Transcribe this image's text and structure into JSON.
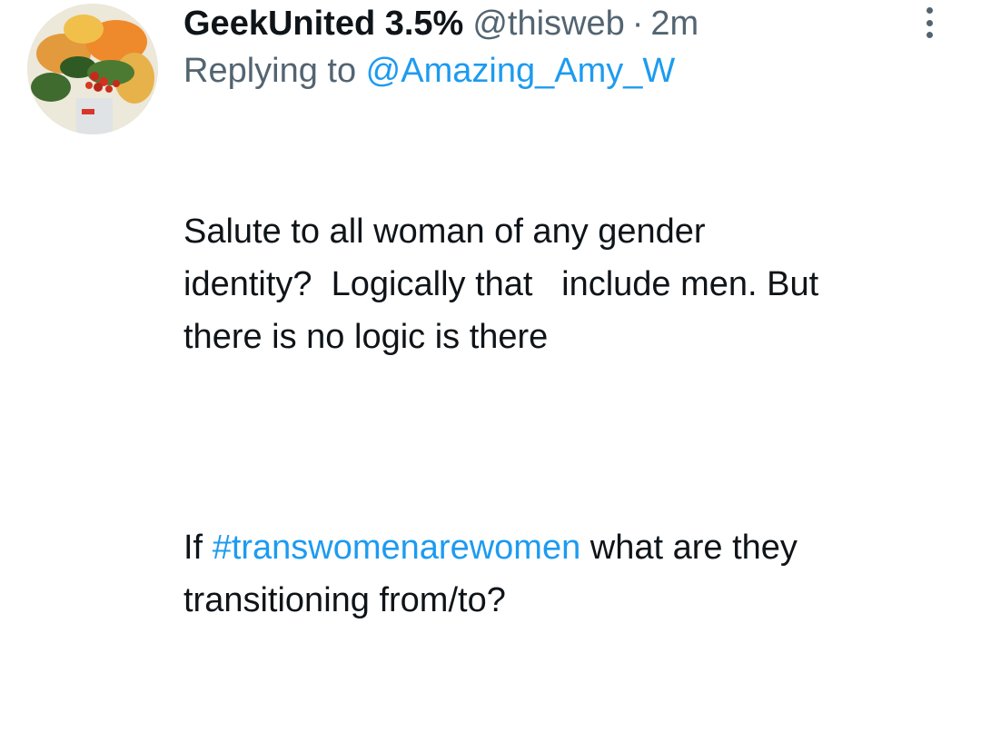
{
  "tweet": {
    "author_name": "GeekUnited 3.5%",
    "author_handle": "@thisweb",
    "separator": "·",
    "time": "2m",
    "replying_prefix": "Replying to ",
    "replying_to": "@Amazing_Amy_W",
    "paragraph1": "Salute to all woman of any gender\nidentity?  Logically that   include men. But\nthere is no logic is there",
    "paragraph2_before": "If ",
    "hashtag": "#transwomenarewomen",
    "paragraph2_after": " what are they\ntransitioning from/to?"
  },
  "icons": {
    "more": "more-vertical-icon",
    "avatar": "flower-bouquet-avatar"
  },
  "colors": {
    "text": "#0f1419",
    "secondary": "#536471",
    "link": "#1d9bf0",
    "background": "#ffffff"
  }
}
